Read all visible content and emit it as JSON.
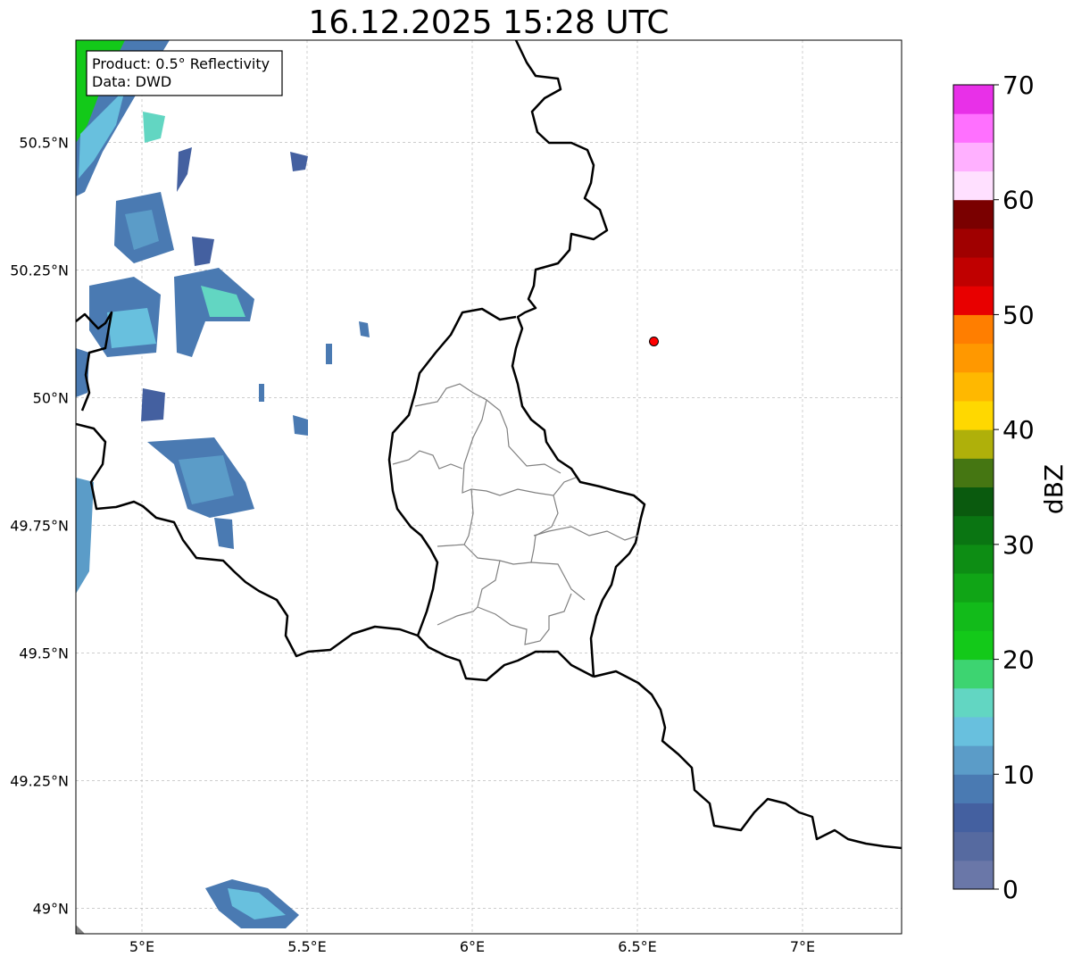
{
  "title": "16.12.2025 15:28 UTC",
  "info_box": {
    "product": "Product: 0.5° Reflectivity",
    "data": "Data: DWD"
  },
  "map": {
    "lon_range": [
      4.8,
      7.3
    ],
    "lat_range": [
      48.95,
      50.7
    ],
    "lon_ticks": [
      {
        "value": 5.0,
        "label": "5°E"
      },
      {
        "value": 5.5,
        "label": "5.5°E"
      },
      {
        "value": 6.0,
        "label": "6°E"
      },
      {
        "value": 6.5,
        "label": "6.5°E"
      },
      {
        "value": 7.0,
        "label": "7°E"
      }
    ],
    "lat_ticks": [
      {
        "value": 49.0,
        "label": "49°N"
      },
      {
        "value": 49.25,
        "label": "49.25°N"
      },
      {
        "value": 49.5,
        "label": "49.5°N"
      },
      {
        "value": 49.75,
        "label": "49.75°N"
      },
      {
        "value": 50.0,
        "label": "50°N"
      },
      {
        "value": 50.25,
        "label": "50.25°N"
      },
      {
        "value": 50.5,
        "label": "50.5°N"
      }
    ],
    "grid": true,
    "radar_site": {
      "lon": 6.55,
      "lat": 50.11,
      "color": "#ff0000"
    },
    "border_color": "#000000",
    "district_color": "#808080"
  },
  "colorbar": {
    "label": "dBZ",
    "min": 0,
    "max": 70,
    "tick_labels": [
      "0",
      "10",
      "20",
      "30",
      "40",
      "50",
      "60",
      "70"
    ],
    "colors": [
      "#6a77a8",
      "#566aa0",
      "#4460a0",
      "#4a7ab2",
      "#5b9cc8",
      "#68c0de",
      "#62d6c2",
      "#3dd471",
      "#13c919",
      "#12bb1a",
      "#10a516",
      "#0d8d14",
      "#0a7512",
      "#0a5a0e",
      "#457612",
      "#afb00a",
      "#ffd800",
      "#ffb800",
      "#ff9800",
      "#ff7e00",
      "#e80000",
      "#c00000",
      "#a00000",
      "#7a0000",
      "#ffe0ff",
      "#ffb0ff",
      "#ff70ff",
      "#e830e8"
    ]
  }
}
